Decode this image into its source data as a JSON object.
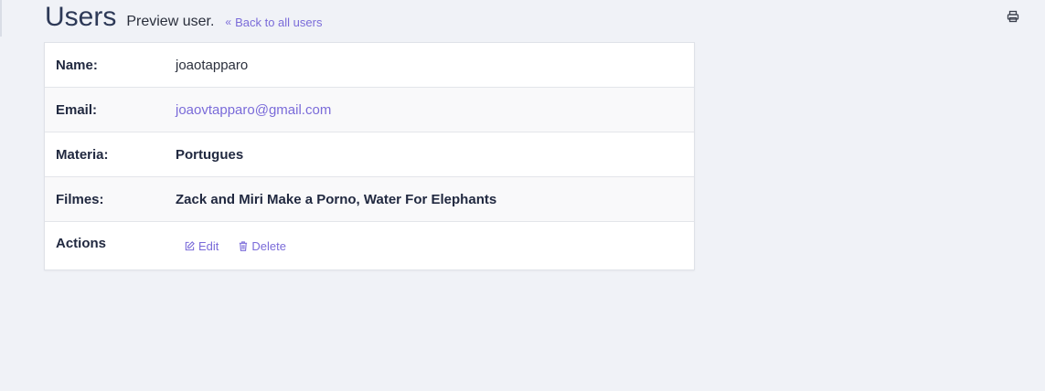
{
  "header": {
    "title": "Users",
    "subtitle": "Preview user.",
    "back_link": "Back to all users"
  },
  "icons": {
    "print": "print-icon",
    "back": "chevron-double-left-icon",
    "edit": "edit-icon",
    "delete": "trash-icon"
  },
  "colors": {
    "accent": "#7a6bd9",
    "background": "#f0f2f7",
    "title": "#2d3957"
  },
  "details": [
    {
      "label": "Name:",
      "value": "joaotapparo"
    },
    {
      "label": "Email:",
      "value": "joaovtapparo@gmail.com"
    },
    {
      "label": "Materia:",
      "value": "Portugues"
    },
    {
      "label": "Filmes:",
      "value": "Zack and Miri Make a Porno, Water For Elephants"
    }
  ],
  "actions": {
    "label": "Actions",
    "edit": "Edit",
    "delete": "Delete"
  }
}
